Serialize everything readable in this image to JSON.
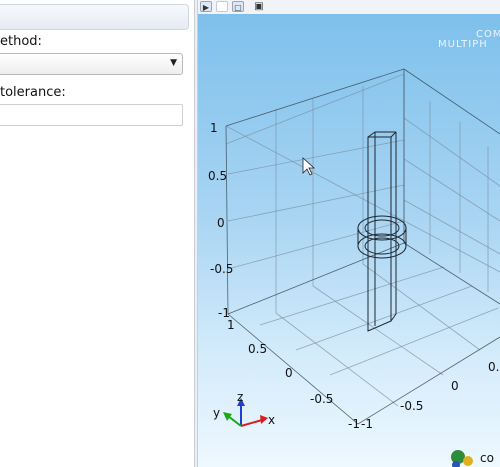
{
  "settings": {
    "method_label": "ethod:",
    "tolerance_label": "tolerance:",
    "tolerance_value": ""
  },
  "graphics": {
    "watermark_line1": "COM",
    "watermark_line2": "MULTIPH",
    "logo_text": "co",
    "axis_ticks": {
      "vertical": [
        "1",
        "0.5",
        "0",
        "-0.5",
        "-1"
      ],
      "left_horizontal": [
        "1",
        "0.5",
        "0",
        "-0.5",
        "-1"
      ],
      "right_horizontal": [
        "-1",
        "-0.5",
        "0",
        "0."
      ]
    },
    "triad": {
      "x": "x",
      "y": "y",
      "z": "z"
    },
    "colors": {
      "x_axis": "#d42020",
      "y_axis": "#1aa81a",
      "z_axis": "#1f3fd0"
    }
  }
}
